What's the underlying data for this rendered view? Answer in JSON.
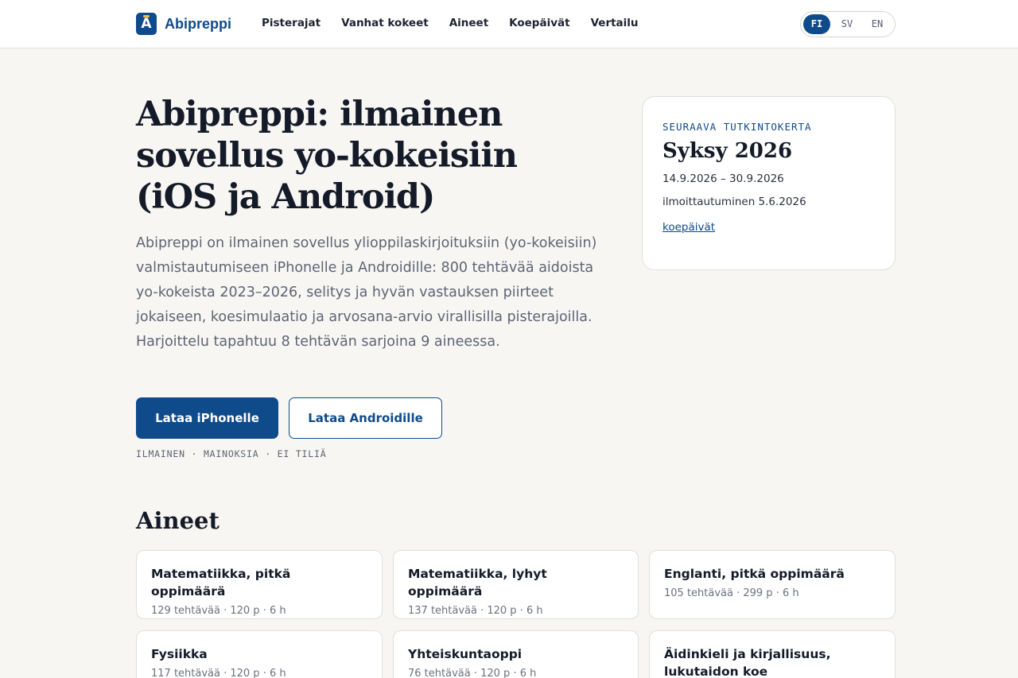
{
  "header": {
    "brand": "Abipreppi",
    "nav": [
      "Pisterajat",
      "Vanhat kokeet",
      "Aineet",
      "Koepäivät",
      "Vertailu"
    ],
    "languages": [
      {
        "code": "FI",
        "active": true
      },
      {
        "code": "SV",
        "active": false
      },
      {
        "code": "EN",
        "active": false
      }
    ]
  },
  "hero": {
    "title": "Abipreppi: ilmainen sovellus yo-kokeisiin (iOS ja Android)",
    "description": "Abipreppi on ilmainen sovellus ylioppilaskirjoituksiin (yo-kokeisiin) valmistautumiseen iPhonelle ja Androidille: 800 tehtävää aidoista yo-kokeista 2023–2026, selitys ja hyvän vastauksen piirteet jokaiseen, koesimulaatio ja arvosana-arvio virallisilla pisterajoilla. Harjoittelu tapahtuu 8 tehtävän sarjoina 9 aineessa.",
    "primary_button": "Lataa iPhonelle",
    "secondary_button": "Lataa Androidille",
    "tagline": "ILMAINEN · MAINOKSIA · EI TILIÄ"
  },
  "exam": {
    "kicker": "SEURAAVA TUTKINTOKERTA",
    "title": "Syksy 2026",
    "dates": "14.9.2026 – 30.9.2026",
    "registration": "ilmoittautuminen 5.6.2026",
    "link": "koepäivät"
  },
  "subjects": {
    "title": "Aineet",
    "items": [
      {
        "name": "Matematiikka, pitkä oppimäärä",
        "meta": "129 tehtävää · 120 p · 6 h"
      },
      {
        "name": "Matematiikka, lyhyt oppimäärä",
        "meta": "137 tehtävää · 120 p · 6 h"
      },
      {
        "name": "Englanti, pitkä oppimäärä",
        "meta": "105 tehtävää · 299 p · 6 h"
      },
      {
        "name": "Fysiikka",
        "meta": "117 tehtävää · 120 p · 6 h"
      },
      {
        "name": "Yhteiskuntaoppi",
        "meta": "76 tehtävää · 120 p · 6 h"
      },
      {
        "name": "Äidinkieli ja kirjallisuus, lukutaidon koe",
        "meta": ""
      }
    ]
  }
}
